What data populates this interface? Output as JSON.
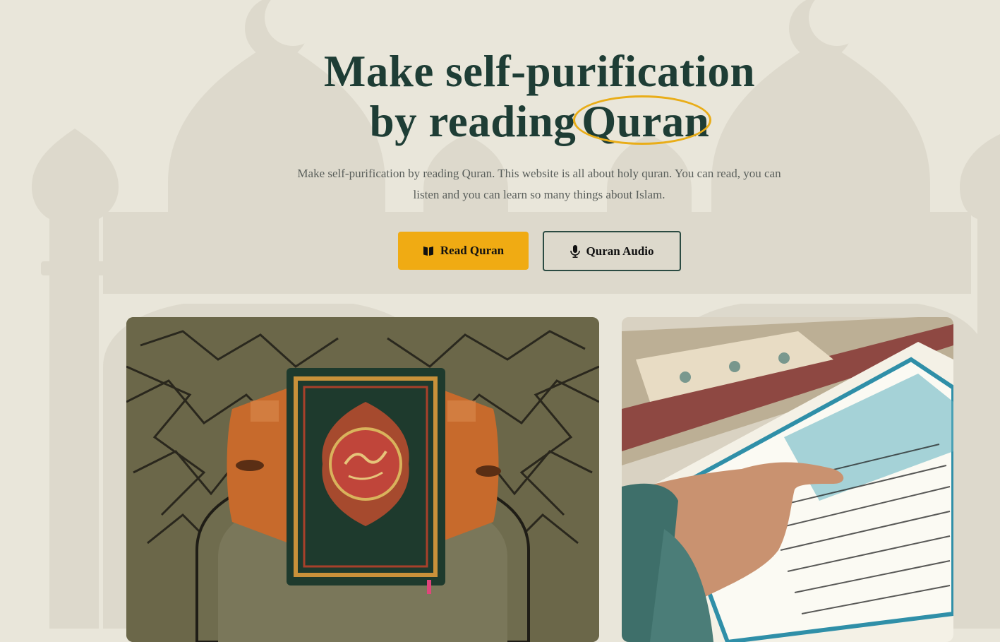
{
  "hero": {
    "title_line1": "Make self-purification",
    "title_line2_prefix": "by reading",
    "title_highlight": "Quran",
    "subtitle": "Make self-purification by reading Quran. This website is all about holy quran. You can read, you can listen and you can learn so many things about Islam."
  },
  "buttons": {
    "read_label": "Read Quran",
    "read_icon": "book-open-icon",
    "audio_label": "Quran Audio",
    "audio_icon": "microphone-icon"
  },
  "images": {
    "left": "quran-on-prayer-rug-photo",
    "right": "hand-reading-quran-photo"
  },
  "colors": {
    "background": "#e9e6da",
    "title": "#1e3d35",
    "accent": "#f0ab13",
    "outline": "#2b4b42"
  }
}
